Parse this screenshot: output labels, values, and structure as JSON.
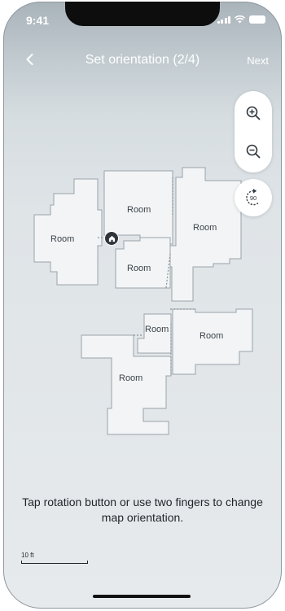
{
  "status_bar": {
    "time": "9:41"
  },
  "header": {
    "title": "Set orientation (2/4)",
    "next_label": "Next"
  },
  "controls": {
    "rotate_value": "90"
  },
  "rooms": [
    "Room",
    "Room",
    "Room",
    "Room",
    "Room",
    "Room",
    "Room"
  ],
  "instruction": "Tap rotation button or use two fingers to change map orientation.",
  "scale": {
    "label": "10 ft"
  },
  "icons": {
    "back": "chevron-left-icon",
    "zoom_in": "zoom-in-icon",
    "zoom_out": "zoom-out-icon",
    "rotate": "rotate-icon",
    "home": "home-icon"
  },
  "colors": {
    "room_fill": "#f2f4f6",
    "room_stroke": "#9aa3ab",
    "text": "#1f2429"
  }
}
